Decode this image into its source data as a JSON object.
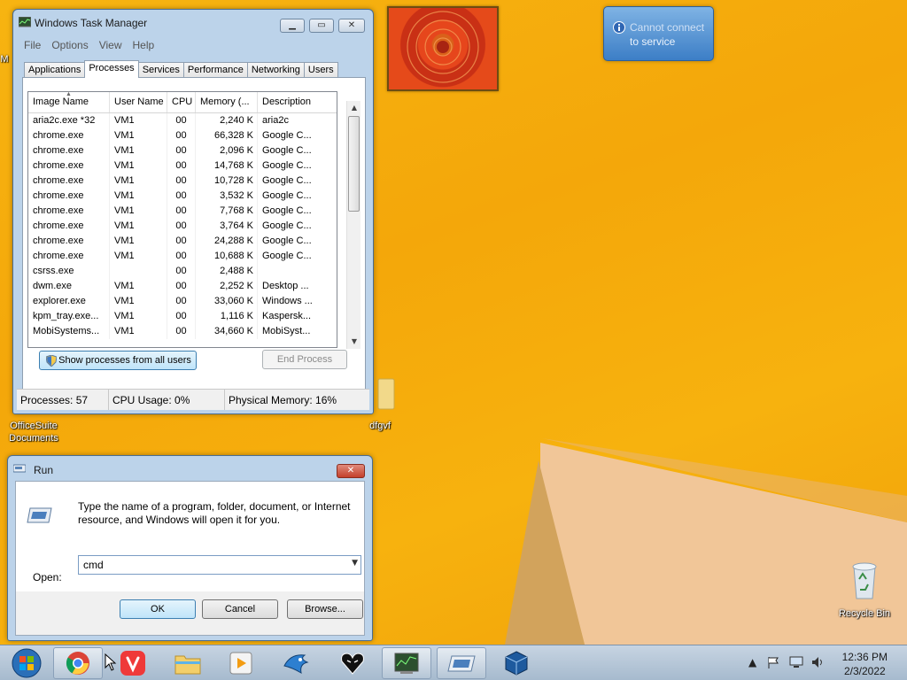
{
  "desktop": {
    "icons": [
      {
        "label_line1": "OfficeSuite",
        "label_line2": "Documents"
      },
      {
        "label_line1": "dfgvf",
        "label_line2": ""
      },
      {
        "label_line1": "Recycle Bin",
        "label_line2": ""
      }
    ],
    "left_edge_glyph": "M"
  },
  "notification": {
    "line1": "Cannot connect",
    "line2": "to service"
  },
  "task_manager": {
    "title": "Windows Task Manager",
    "menu": [
      "File",
      "Options",
      "View",
      "Help"
    ],
    "tabs": [
      "Applications",
      "Processes",
      "Services",
      "Performance",
      "Networking",
      "Users"
    ],
    "active_tab": "Processes",
    "columns": [
      "Image Name",
      "User Name",
      "CPU",
      "Memory (...",
      "Description"
    ],
    "rows": [
      [
        "aria2c.exe *32",
        "VM1",
        "00",
        "2,240 K",
        "aria2c"
      ],
      [
        "chrome.exe",
        "VM1",
        "00",
        "66,328 K",
        "Google C..."
      ],
      [
        "chrome.exe",
        "VM1",
        "00",
        "2,096 K",
        "Google C..."
      ],
      [
        "chrome.exe",
        "VM1",
        "00",
        "14,768 K",
        "Google C..."
      ],
      [
        "chrome.exe",
        "VM1",
        "00",
        "10,728 K",
        "Google C..."
      ],
      [
        "chrome.exe",
        "VM1",
        "00",
        "3,532 K",
        "Google C..."
      ],
      [
        "chrome.exe",
        "VM1",
        "00",
        "7,768 K",
        "Google C..."
      ],
      [
        "chrome.exe",
        "VM1",
        "00",
        "3,764 K",
        "Google C..."
      ],
      [
        "chrome.exe",
        "VM1",
        "00",
        "24,288 K",
        "Google C..."
      ],
      [
        "chrome.exe",
        "VM1",
        "00",
        "10,688 K",
        "Google C..."
      ],
      [
        "csrss.exe",
        "",
        "00",
        "2,488 K",
        ""
      ],
      [
        "dwm.exe",
        "VM1",
        "00",
        "2,252 K",
        "Desktop ..."
      ],
      [
        "explorer.exe",
        "VM1",
        "00",
        "33,060 K",
        "Windows ..."
      ],
      [
        "kpm_tray.exe...",
        "VM1",
        "00",
        "1,116 K",
        "Kaspersk..."
      ],
      [
        "MobiSystems...",
        "VM1",
        "00",
        "34,660 K",
        "MobiSyst..."
      ]
    ],
    "show_all_button": "Show processes from all users",
    "end_process_button": "End Process",
    "status": {
      "processes": "Processes: 57",
      "cpu": "CPU Usage: 0%",
      "memory": "Physical Memory: 16%"
    }
  },
  "run_dialog": {
    "title": "Run",
    "description_line1": "Type the name of a program, folder, document, or Internet",
    "description_line2": "resource, and Windows will open it for you.",
    "open_label": "Open:",
    "open_value": "cmd",
    "ok": "OK",
    "cancel": "Cancel",
    "browse": "Browse..."
  },
  "taskbar": {
    "apps": [
      "start",
      "chrome",
      "vivaldi",
      "file-explorer",
      "media-player",
      "bird-app",
      "heart-app",
      "task-manager",
      "run",
      "virtualbox"
    ],
    "clock_time": "12:36 PM",
    "clock_date": "2/3/2022"
  },
  "colors": {
    "desktop": "#f6ad0c",
    "window_frame": "#bcd3ea",
    "taskbar": "#b7c7d8",
    "notification": "#4a8ed0"
  }
}
